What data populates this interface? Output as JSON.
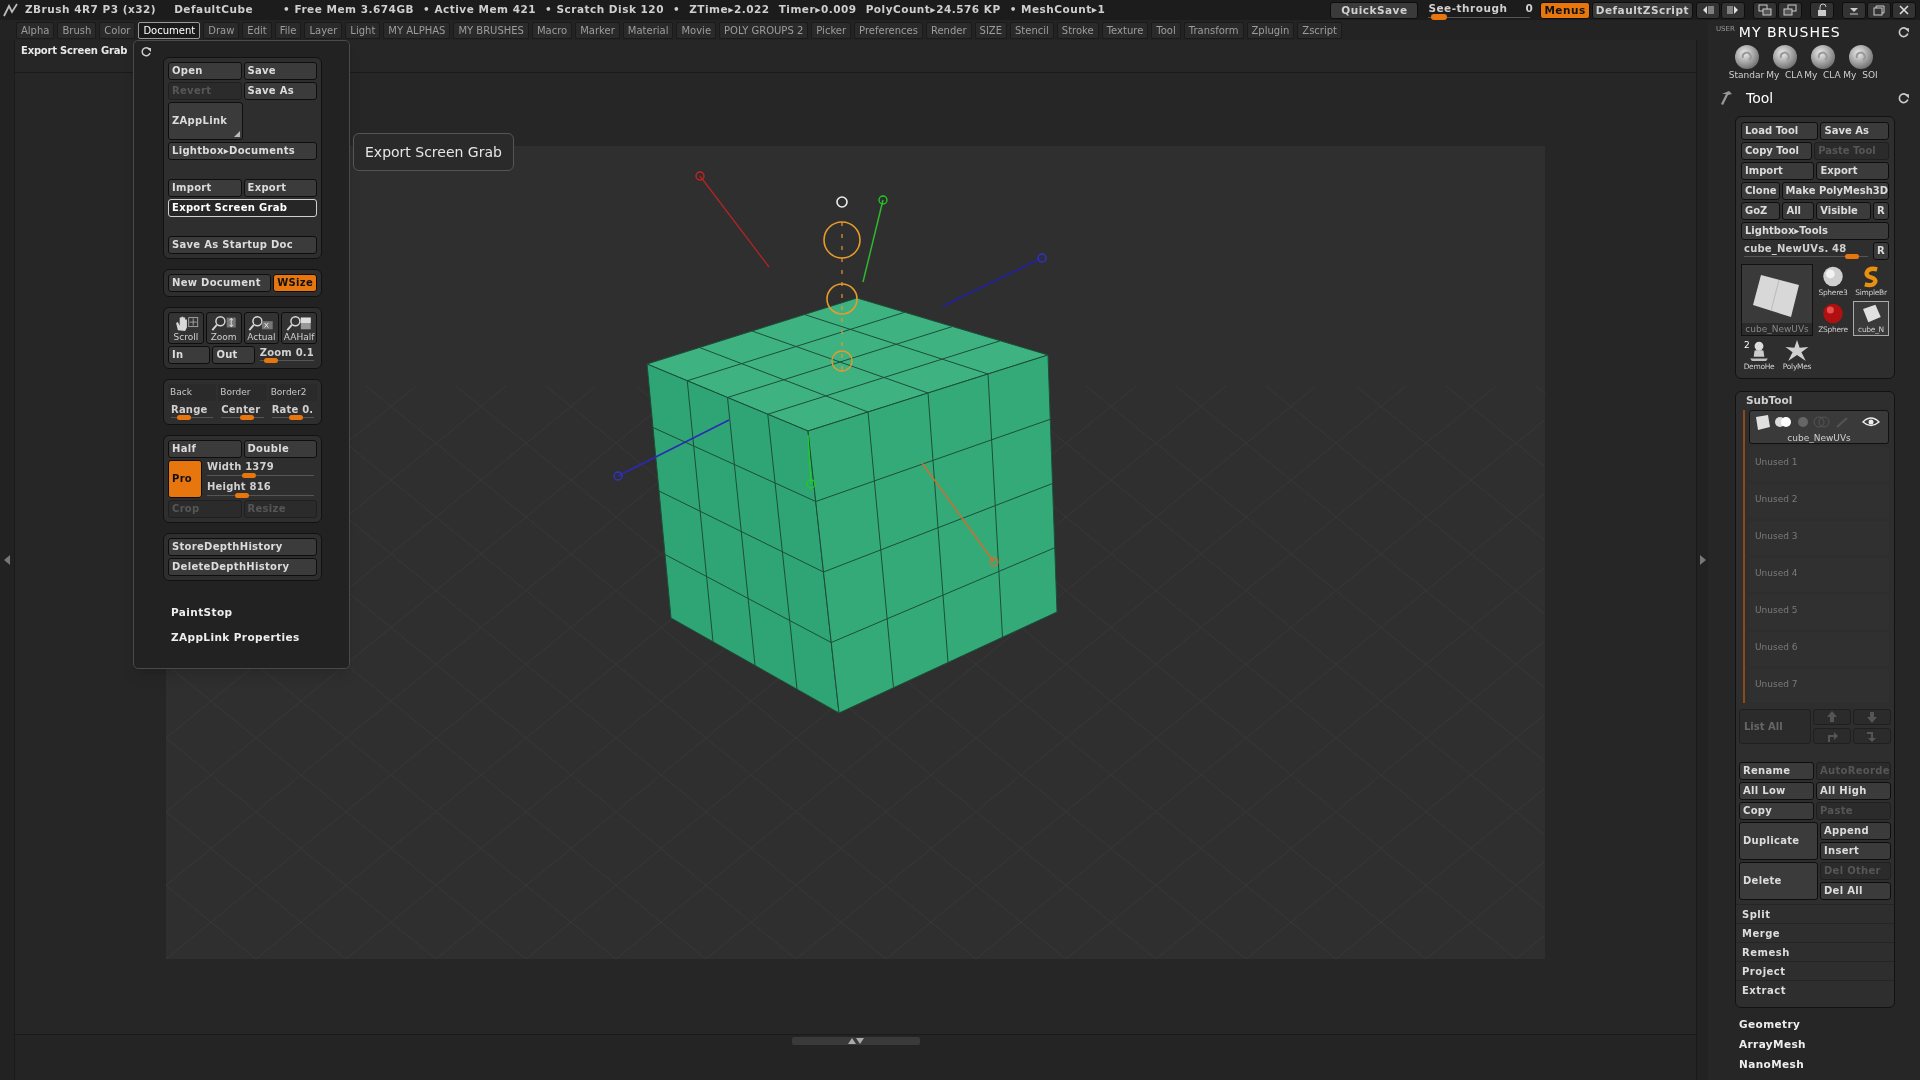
{
  "title_bar": {
    "app": "ZBrush 4R7 P3 (x32)",
    "document": "DefaultCube",
    "stats": [
      "• Free Mem 3.674GB",
      "• Active Mem 421",
      "• Scratch Disk 120",
      "•",
      "ZTime▸2.022",
      "Timer▸0.009",
      "PolyCount▸24.576 KP",
      "• MeshCount▸1"
    ],
    "quicksave": "QuickSave",
    "see_through": {
      "label": "See-through",
      "value": "0",
      "level": 0.08
    },
    "menus": {
      "label": "Menus",
      "on": true
    },
    "script": "DefaultZScript"
  },
  "menu_bar": [
    {
      "label": "Alpha",
      "selected": false
    },
    {
      "label": "Brush",
      "selected": false
    },
    {
      "label": "Color",
      "selected": false
    },
    {
      "label": "Document",
      "selected": true
    },
    {
      "label": "Draw",
      "selected": false
    },
    {
      "label": "Edit",
      "selected": false
    },
    {
      "label": "File",
      "selected": false
    },
    {
      "label": "Layer",
      "selected": false
    },
    {
      "label": "Light",
      "selected": false
    },
    {
      "label": "MY ALPHAS",
      "selected": false
    },
    {
      "label": "MY BRUSHES",
      "selected": false
    },
    {
      "label": "Macro",
      "selected": false
    },
    {
      "label": "Marker",
      "selected": false
    },
    {
      "label": "Material",
      "selected": false
    },
    {
      "label": "Movie",
      "selected": false
    },
    {
      "label": "POLY GROUPS 2",
      "selected": false
    },
    {
      "label": "Picker",
      "selected": false
    },
    {
      "label": "Preferences",
      "selected": false
    },
    {
      "label": "Render",
      "selected": false
    },
    {
      "label": "SIZE",
      "selected": false
    },
    {
      "label": "Stencil",
      "selected": false
    },
    {
      "label": "Stroke",
      "selected": false
    },
    {
      "label": "Texture",
      "selected": false
    },
    {
      "label": "Tool",
      "selected": false
    },
    {
      "label": "Transform",
      "selected": false
    },
    {
      "label": "Zplugin",
      "selected": false
    },
    {
      "label": "Zscript",
      "selected": false
    }
  ],
  "palette_title": "Export Screen Grab",
  "document_popup": {
    "groups": [
      {
        "blocks": [
          [
            [
              {
                "kind": "button",
                "label": "Open"
              },
              {
                "kind": "button",
                "label": "Save"
              }
            ],
            [
              {
                "kind": "disabled_button",
                "label": "Revert"
              },
              {
                "kind": "button",
                "label": "Save As"
              }
            ],
            [
              {
                "kind": "tall_button",
                "label": "ZAppLink"
              }
            ],
            [
              {
                "kind": "button",
                "label": "Lightbox▸Documents"
              }
            ]
          ],
          [
            [
              {
                "kind": "button",
                "label": "Import"
              },
              {
                "kind": "button",
                "label": "Export"
              }
            ],
            [
              {
                "kind": "highlighted_button",
                "label": "Export Screen Grab"
              }
            ]
          ],
          [
            [
              {
                "kind": "button",
                "label": "Save As Startup Doc"
              }
            ]
          ]
        ]
      },
      {
        "blocks": [
          [
            [
              {
                "kind": "button",
                "label": "New Document"
              },
              {
                "kind": "small_on_button",
                "label": "WSize"
              }
            ]
          ]
        ]
      },
      {
        "blocks": [
          [
            [
              {
                "kind": "icon_button",
                "label": "Scroll"
              },
              {
                "kind": "icon_button",
                "label": "Zoom"
              },
              {
                "kind": "icon_button",
                "label": "Actual"
              },
              {
                "kind": "icon_button",
                "label": "AAHalf"
              }
            ],
            [
              {
                "kind": "button",
                "label": "In"
              },
              {
                "kind": "button",
                "label": "Out"
              },
              {
                "kind": "slider",
                "label": "Zoom",
                "value": "0.1",
                "level": 0.1
              }
            ]
          ]
        ]
      },
      {
        "blocks": [
          [
            [
              {
                "kind": "swatch",
                "label": "Back"
              },
              {
                "kind": "swatch",
                "label": "Border"
              },
              {
                "kind": "swatch",
                "label": "Border2"
              }
            ],
            [
              {
                "kind": "slider",
                "label": "Range",
                "level": 0.2
              },
              {
                "kind": "slider",
                "label": "Center",
                "level": 0.65
              },
              {
                "kind": "slider",
                "label": "Rate",
                "value": "0.",
                "level": 0.6
              }
            ]
          ]
        ]
      },
      {
        "blocks": [
          [
            [
              {
                "kind": "button",
                "label": "Half"
              },
              {
                "kind": "button",
                "label": "Double"
              }
            ],
            [
              {
                "kind": "square_on_button",
                "label": "Pro"
              },
              {
                "kind": "column",
                "items": [
                  {
                    "kind": "slider",
                    "label": "Width",
                    "value": "1379",
                    "level": 0.38
                  },
                  {
                    "kind": "slider",
                    "label": "Height",
                    "value": "816",
                    "level": 0.3
                  }
                ]
              }
            ],
            [
              {
                "kind": "disabled_button",
                "label": "Crop"
              },
              {
                "kind": "disabled_button",
                "label": "Resize"
              }
            ]
          ]
        ]
      },
      {
        "blocks": [
          [
            [
              {
                "kind": "button",
                "label": "StoreDepthHistory"
              }
            ],
            [
              {
                "kind": "button",
                "label": "DeleteDepthHistory"
              }
            ]
          ]
        ]
      }
    ],
    "subpalettes": [
      "PaintStop",
      "ZAppLink Properties"
    ]
  },
  "tooltip": "Export Screen Grab",
  "right_panel": {
    "user_label": "USER",
    "brushes_title": "MY BRUSHES",
    "brushes": [
      "Standar",
      "My  CLA",
      "My  CLA",
      "My  SOI"
    ],
    "tool_title": "Tool",
    "tool_rows": [
      [
        {
          "kind": "button",
          "label": "Load Tool"
        },
        {
          "kind": "button",
          "label": "Save As"
        }
      ],
      [
        {
          "kind": "button",
          "label": "Copy Tool"
        },
        {
          "kind": "disabled_button",
          "label": "Paste Tool"
        }
      ],
      [
        {
          "kind": "button",
          "label": "Import"
        },
        {
          "kind": "button",
          "label": "Export"
        }
      ],
      [
        {
          "kind": "button",
          "label": "Clone"
        },
        {
          "kind": "button",
          "label": "Make PolyMesh3D"
        }
      ],
      [
        {
          "kind": "button",
          "label": "GoZ"
        },
        {
          "kind": "button",
          "label": "All"
        },
        {
          "kind": "button",
          "label": "Visible"
        },
        {
          "kind": "small_button",
          "label": "R"
        }
      ],
      [
        {
          "kind": "button",
          "label": "Lightbox▸Tools"
        }
      ],
      [
        {
          "kind": "slider",
          "label": "cube_NewUVs.",
          "value": "48",
          "level": 0.92
        },
        {
          "kind": "small_button",
          "label": "R"
        }
      ]
    ],
    "current_tool": "cube_NewUVs",
    "thumbnails": [
      {
        "label": "Sphere3",
        "selected": false
      },
      {
        "label": "SimpleBr",
        "selected": false
      },
      {
        "label": "ZSphere",
        "selected": false
      },
      {
        "label": "cube_N",
        "selected": true
      },
      {
        "label": "DemoHe",
        "badge": "2",
        "selected": false
      },
      {
        "label": "PolyMes",
        "selected": false
      }
    ],
    "subtool": {
      "title": "SubTool",
      "item": "cube_NewUVs",
      "unused": [
        "Unused 1",
        "Unused 2",
        "Unused 3",
        "Unused 4",
        "Unused 5",
        "Unused 6",
        "Unused 7"
      ],
      "list_all": "List All",
      "rows": [
        [
          {
            "kind": "button",
            "label": "Rename"
          },
          {
            "kind": "disabled_button",
            "label": "AutoReorde"
          }
        ],
        [
          {
            "kind": "button",
            "label": "All Low"
          },
          {
            "kind": "button",
            "label": "All High"
          }
        ],
        [
          {
            "kind": "button",
            "label": "Copy"
          },
          {
            "kind": "disabled_button",
            "label": "Paste"
          }
        ],
        [
          {
            "kind": "tall_button",
            "label": "Duplicate"
          },
          {
            "kind": "column",
            "items": [
              {
                "kind": "button",
                "label": "Append"
              },
              {
                "kind": "button",
                "label": "Insert"
              }
            ]
          }
        ],
        [
          {
            "kind": "tall_button",
            "label": "Delete"
          },
          {
            "kind": "column",
            "items": [
              {
                "kind": "disabled_button",
                "label": "Del Other"
              },
              {
                "kind": "button",
                "label": "Del All"
              }
            ]
          }
        ]
      ],
      "actions": [
        "Split",
        "Merge",
        "Remesh",
        "Project",
        "Extract"
      ]
    },
    "sections": [
      "Geometry",
      "ArrayMesh",
      "NanoMesh"
    ]
  }
}
